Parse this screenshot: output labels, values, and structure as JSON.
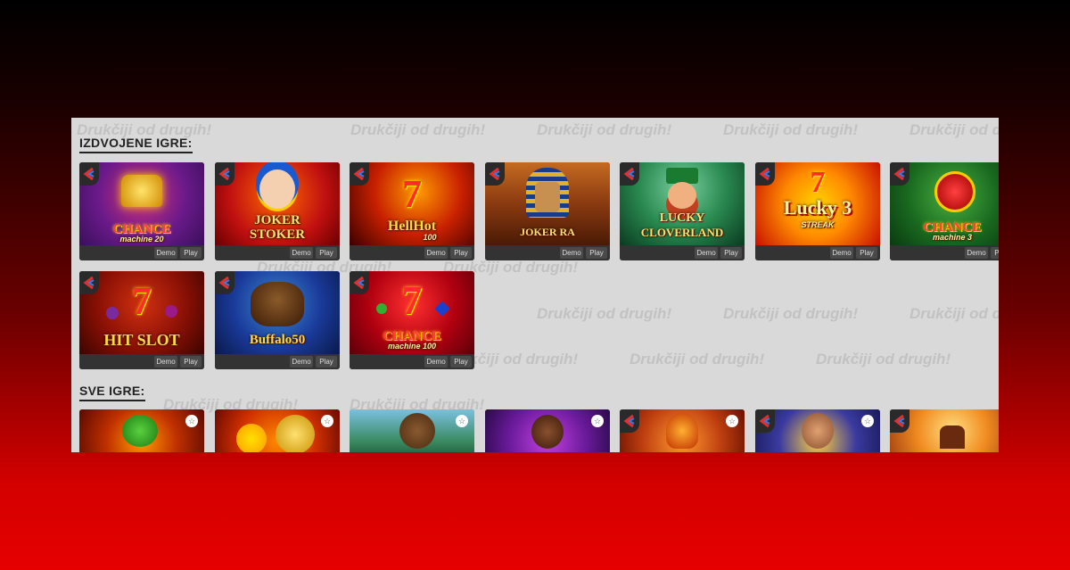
{
  "watermark_text": "Drukčiji od drugih!",
  "sections": {
    "featured_title": "IZDVOJENE IGRE:",
    "all_title": "SVE IGRE:"
  },
  "buttons": {
    "demo": "Demo",
    "play": "Play"
  },
  "featured_games": [
    {
      "title": "CHANCE",
      "subtitle": "machine 20"
    },
    {
      "title": "JOKER",
      "subtitle": "STOKER"
    },
    {
      "title": "HellHot",
      "subtitle": "100"
    },
    {
      "title": "JOKER RA",
      "subtitle": ""
    },
    {
      "title": "LUCKY",
      "subtitle": "CLOVERLAND"
    },
    {
      "title": "Lucky 3",
      "subtitle": "STREAK"
    },
    {
      "title": "CHANCE",
      "subtitle": "machine 3"
    },
    {
      "title": "HIT SLOT",
      "subtitle": ""
    },
    {
      "title": "Buffalo50",
      "subtitle": ""
    },
    {
      "title": "CHANCE",
      "subtitle": "machine 100"
    }
  ],
  "colors": {
    "background_top": "#000000",
    "background_bottom": "#e60000",
    "panel": "#d9d9d9",
    "card_bar": "#333333"
  },
  "icons": {
    "provider_badge": "provider-logo-icon",
    "favorite": "star-icon"
  }
}
